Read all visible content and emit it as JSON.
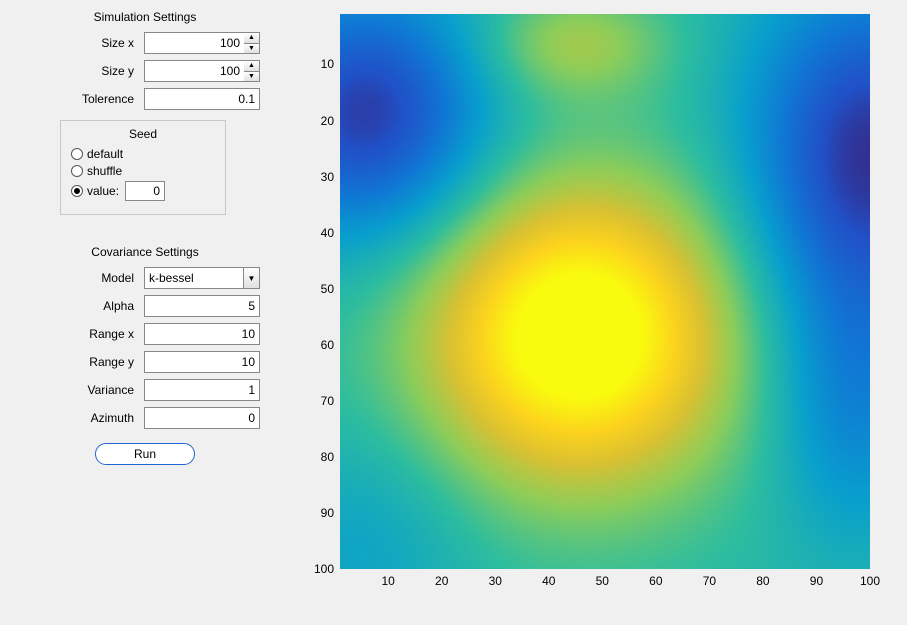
{
  "sim": {
    "title": "Simulation Settings",
    "size_x_label": "Size x",
    "size_x_value": "100",
    "size_y_label": "Size y",
    "size_y_value": "100",
    "tolerance_label": "Tolerence",
    "tolerance_value": "0.1",
    "seed": {
      "title": "Seed",
      "opt_default": "default",
      "opt_shuffle": "shuffle",
      "opt_value_label": "value:",
      "value": "0",
      "selected": "value"
    }
  },
  "cov": {
    "title": "Covariance Settings",
    "model_label": "Model",
    "model_value": "k-bessel",
    "alpha_label": "Alpha",
    "alpha_value": "5",
    "range_x_label": "Range x",
    "range_x_value": "10",
    "range_y_label": "Range y",
    "range_y_value": "10",
    "variance_label": "Variance",
    "variance_value": "1",
    "azimuth_label": "Azimuth",
    "azimuth_value": "0"
  },
  "run_label": "Run",
  "chart_data": {
    "type": "heatmap",
    "x_ticks": [
      10,
      20,
      30,
      40,
      50,
      60,
      70,
      80,
      90,
      100
    ],
    "y_ticks": [
      10,
      20,
      30,
      40,
      50,
      60,
      70,
      80,
      90,
      100
    ],
    "xlim": [
      1,
      100
    ],
    "ylim": [
      1,
      100
    ],
    "y_dir": "reverse",
    "colormap": "parula",
    "value_range_estimate": [
      -2.5,
      2.5
    ],
    "note": "Smooth 2D Gaussian random field (k-bessel covariance). Hot blob centered near (45,60), cool lobes top-left and right edge. Values estimated from colormap, not labeled.",
    "grid_resolution": 100
  }
}
